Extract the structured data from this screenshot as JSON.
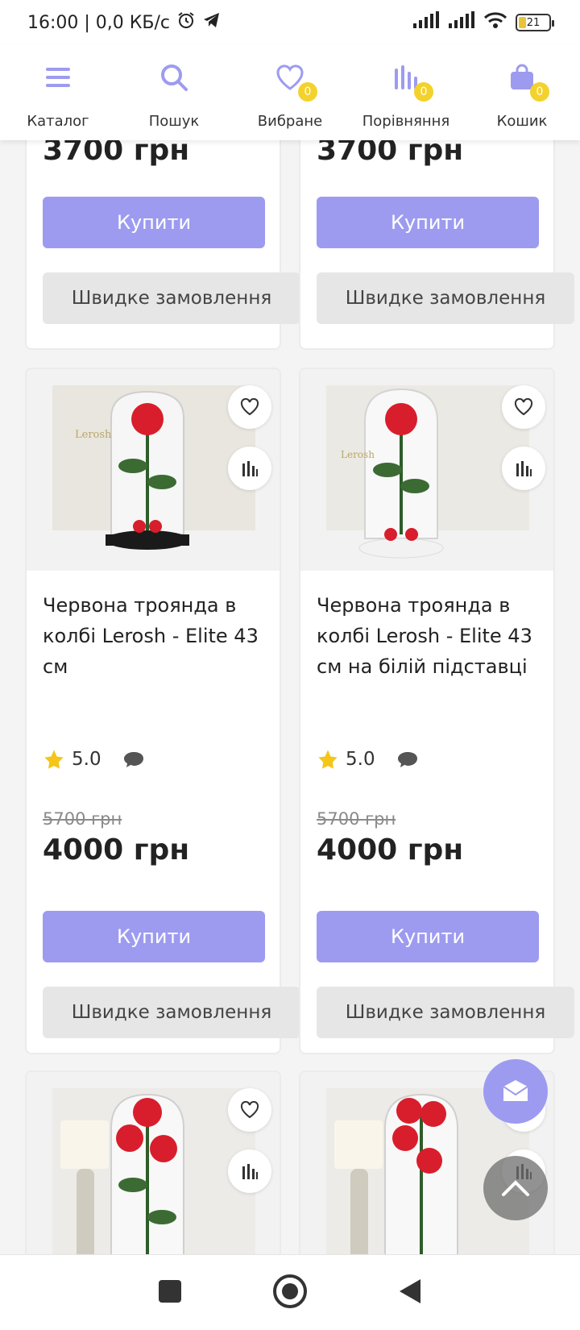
{
  "status_bar": {
    "time_speed": "16:00 | 0,0 КБ/с",
    "battery": "21"
  },
  "nav": {
    "items": [
      {
        "label": "Каталог",
        "icon": "menu-icon"
      },
      {
        "label": "Пошук",
        "icon": "search-icon"
      },
      {
        "label": "Вибране",
        "icon": "heart-icon",
        "badge": "0"
      },
      {
        "label": "Порівняння",
        "icon": "compare-icon",
        "badge": "0"
      },
      {
        "label": "Кошик",
        "icon": "bag-icon",
        "badge": "0"
      }
    ]
  },
  "colors": {
    "accent": "#9d9bf0",
    "badge": "#f3d22c",
    "star": "#f5c518"
  },
  "products": [
    {
      "price": "3700 грн",
      "buy_label": "Купити",
      "quick_label": "Швидке замовлення"
    },
    {
      "price": "3700 грн",
      "buy_label": "Купити",
      "quick_label": "Швидке замовлення"
    },
    {
      "title": "Червона троянда в колбі Lerosh - Elite 43 см",
      "rating": "5.0",
      "old_price": "5700 грн",
      "price": "4000 грн",
      "buy_label": "Купити",
      "quick_label": "Швидке замовлення"
    },
    {
      "title": "Червона троянда в колбі Lerosh - Elite 43 см на білій підставці",
      "rating": "5.0",
      "old_price": "5700 грн",
      "price": "4000 грн",
      "buy_label": "Купити",
      "quick_label": "Швидке замовлення"
    },
    {},
    {}
  ]
}
